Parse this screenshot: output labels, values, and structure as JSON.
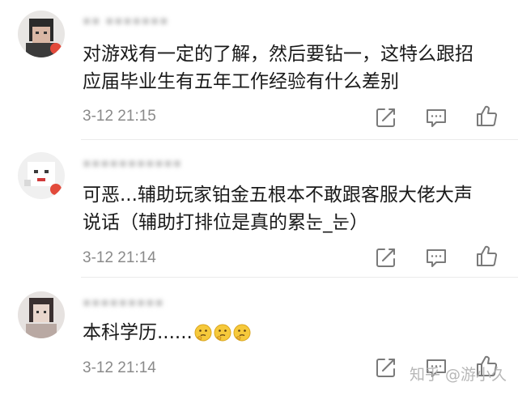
{
  "comments": [
    {
      "username": "▪▪ ▪▪▪▪▪▪▪",
      "content": "对游戏有一定的了解，然后要钻一，这特么跟招\n应届毕业生有五年工作经验有什么差别",
      "time": "3-12 21:15"
    },
    {
      "username": "▪▪▪▪▪▪▪▪▪▪▪",
      "content": "可恶...辅助玩家铂金五根本不敢跟客服大佬大声\n说话（辅助打排位是真的累눈_눈）",
      "time": "3-12 21:14"
    },
    {
      "username": "▪▪▪▪▪▪▪▪▪",
      "content": "本科学历......",
      "time": "3-12 21:14"
    }
  ],
  "watermark": "知乎 @游小久",
  "icons": {
    "reply": "reply-icon",
    "comment": "comment-icon",
    "like": "thumbs-up-icon",
    "emoji": "thinking-face-emoji"
  },
  "colors": {
    "text": "#1a1a1a",
    "time": "#8a8a8a",
    "icon": "#7a7a7a",
    "divider": "#ebebeb",
    "emoji": "#f6c93b"
  }
}
